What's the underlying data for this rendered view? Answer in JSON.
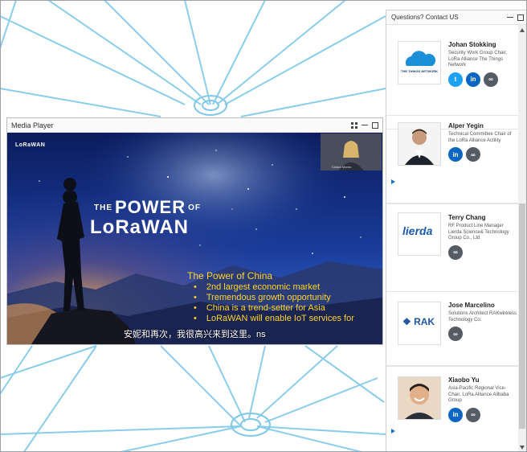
{
  "media_player": {
    "title": "Media Player",
    "video": {
      "logo_text": "LoRaWAN",
      "title_the": "THE",
      "title_power": "POWER",
      "title_of": "OF",
      "title_lorawan": "LoRaWAN",
      "cam_label": "Chiara Monro",
      "slide_heading": "The Power of China",
      "slide_bullets": [
        "2nd largest economic market",
        "Tremendous growth opportunity",
        "China is a trend-setter for Asia",
        "LoRaWAN will enable IoT services for"
      ],
      "subtitle": "安妮和再次，我很高兴来到这里。ns"
    }
  },
  "speaker_panel": {
    "title": "Questions? Contact US",
    "speakers": [
      {
        "name": "Johan Stokking",
        "role": "Security Work Group Chair, LoRa Alliance The Things Network",
        "logo_text": "THE THINGS NETWORK",
        "socials": [
          "twitter",
          "linkedin",
          "link"
        ]
      },
      {
        "name": "Alper Yegin",
        "role": "Technical Committee Chair of the LoRa Alliance Actility",
        "socials": [
          "linkedin",
          "link"
        ]
      },
      {
        "name": "Terry Chang",
        "role": "RF Product Line Manager Lierda Science& Technology Group Co., Ltd",
        "logo_text": "lierda",
        "socials": [
          "link"
        ]
      },
      {
        "name": "Jose Marcelino",
        "role": "Solutions Architect RAKwireless Technology Co.",
        "logo_text": "RAK",
        "socials": [
          "link"
        ]
      },
      {
        "name": "Xiaobo Yu",
        "role": "Asia-Pacific Regional Vice-Chair, LoRa Alliance Alibaba Group",
        "socials": [
          "linkedin",
          "link"
        ]
      }
    ]
  },
  "icons": {
    "twitter": "twitter-icon",
    "linkedin": "linkedin-icon",
    "link": "link-icon"
  },
  "colors": {
    "network_lines": "#7ec8e8",
    "slide_text": "#ffd42a",
    "twitter": "#1da1f2",
    "linkedin": "#0a66c2",
    "link": "#555c66",
    "lierda_blue": "#1a5aa8",
    "rak_blue": "#1f57a4"
  }
}
